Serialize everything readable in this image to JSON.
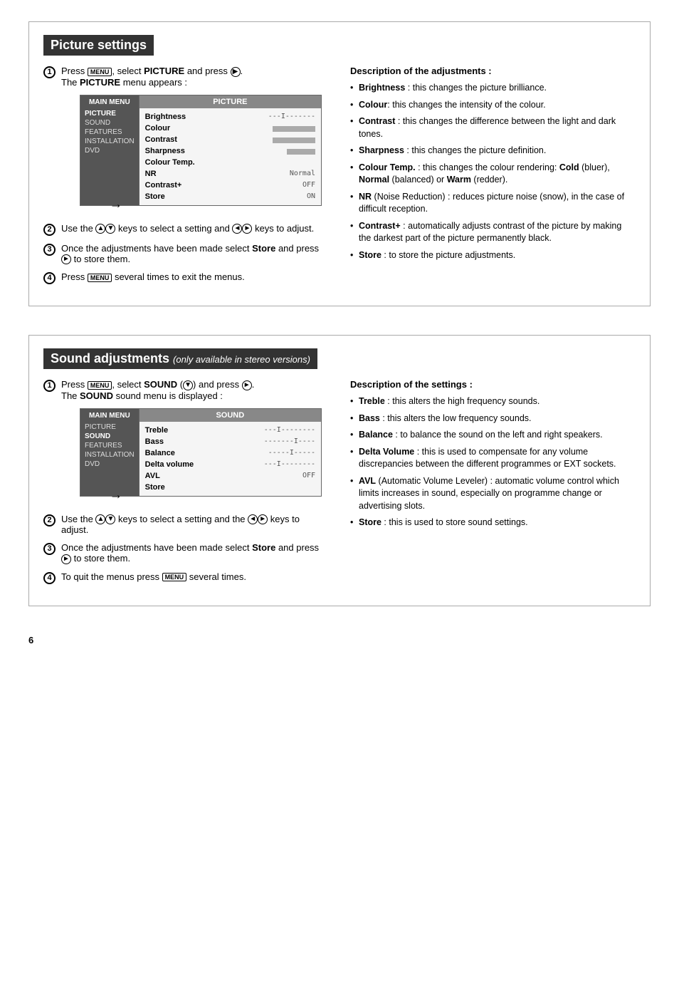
{
  "page": {
    "number": "6"
  },
  "picture_section": {
    "title": "Picture settings",
    "step1": {
      "text_before_bold": "Press ",
      "icon_menu": "MENU",
      "text_middle": ", select ",
      "bold1": "PICTURE",
      "text_after": " and press ",
      "text_line2_before": "The ",
      "bold2": "PICTURE",
      "text_line2_after": " menu appears :"
    },
    "menu": {
      "left_title": "MAIN MENU",
      "left_items": [
        "PICTURE",
        "SOUND",
        "FEATURES",
        "INSTALLATION",
        "DVD"
      ],
      "right_title": "PICTURE",
      "right_rows": [
        {
          "label": "Brightness",
          "value": "---I-------"
        },
        {
          "label": "Colour",
          "value": ""
        },
        {
          "label": "Contrast",
          "value": ""
        },
        {
          "label": "Sharpness",
          "value": ""
        },
        {
          "label": "Colour Temp.",
          "value": ""
        },
        {
          "label": "NR",
          "value": "Normal"
        },
        {
          "label": "Contrast+",
          "value": "OFF"
        },
        {
          "label": "Store",
          "value": "ON"
        }
      ]
    },
    "step2": "Use the ▲▼ keys to select a setting and ◄► keys to adjust.",
    "step3_before": "Once the adjustments have been made select ",
    "step3_bold": "Store",
    "step3_after": " and press ► to store them.",
    "step4": "Press MENU several times to exit the menus.",
    "description_title": "Description of the adjustments :",
    "description_items": [
      {
        "bold": "Brightness",
        "text": " : this changes the picture brilliance."
      },
      {
        "bold": "Colour",
        "text": ": this changes the intensity of the colour."
      },
      {
        "bold": "Contrast",
        "text": " : this changes the difference between the light and dark tones."
      },
      {
        "bold": "Sharpness",
        "text": " : this changes the picture definition."
      },
      {
        "bold": "Colour Temp.",
        "text": " : this changes the colour rendering: Cold (bluer), Normal (balanced) or Warm (redder)."
      },
      {
        "bold": "NR",
        "text": " (Noise Reduction) : reduces picture noise (snow), in the case of difficult reception."
      },
      {
        "bold": "Contrast+",
        "text": " : automatically adjusts contrast of the picture by making the darkest part of the picture permanently black."
      },
      {
        "bold": "Store",
        "text": " : to store the picture adjustments."
      }
    ]
  },
  "sound_section": {
    "title": "Sound adjustments",
    "subtitle": "(only available in stereo versions)",
    "step1_before": "Press ",
    "step1_icon": "MENU",
    "step1_middle": ", select SOUND (▼) and press ►.",
    "step1_line2_before": "The ",
    "step1_bold": "SOUND",
    "step1_line2_after": " sound menu is displayed :",
    "menu": {
      "left_title": "MAIN MENU",
      "left_items": [
        "PICTURE",
        "SOUND",
        "FEATURES",
        "INSTALLATION",
        "DVD"
      ],
      "right_title": "SOUND",
      "right_rows": [
        {
          "label": "Treble",
          "value": "---I--------"
        },
        {
          "label": "Bass",
          "value": "-------I----"
        },
        {
          "label": "Balance",
          "value": "-----I-----"
        },
        {
          "label": "Delta volume",
          "value": "---I--------"
        },
        {
          "label": "AVL",
          "value": "OFF"
        },
        {
          "label": "Store",
          "value": ""
        }
      ]
    },
    "step2_before": "Use the ▲▼ keys to select a setting and the ◄► keys to adjust.",
    "step3_before": "Once the adjustments have been made select ",
    "step3_bold": "Store",
    "step3_after": " and press ► to store them.",
    "step4": "To quit the menus press MENU several times.",
    "description_title": "Description of the settings :",
    "description_items": [
      {
        "bold": "Treble",
        "text": " : this alters the high frequency sounds."
      },
      {
        "bold": "Bass",
        "text": " : this alters the low frequency sounds."
      },
      {
        "bold": "Balance",
        "text": " : to balance the sound on the left and right speakers."
      },
      {
        "bold": "Delta Volume",
        "text": " : this is used to compensate for any volume discrepancies between the different programmes or EXT sockets."
      },
      {
        "bold": "AVL",
        "text": " (Automatic Volume Leveler) : automatic volume control which limits increases in sound, especially on programme change or advertising slots."
      },
      {
        "bold": "Store",
        "text": " : this is used to store sound settings."
      }
    ]
  }
}
